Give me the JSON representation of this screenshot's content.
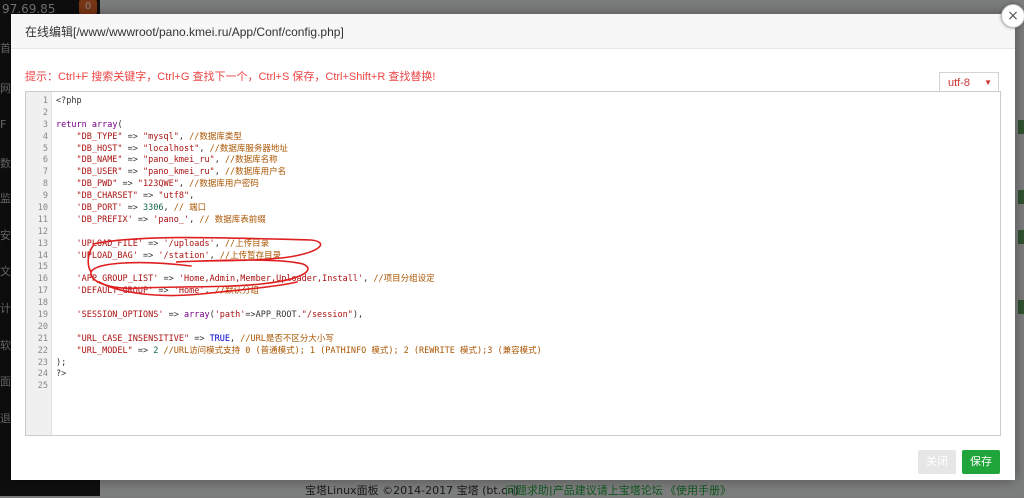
{
  "background": {
    "server_ip": "97.69.85",
    "badge": "0",
    "sidebar_glyphs": [
      "首",
      "网",
      "F",
      "数",
      "监",
      "安",
      "文",
      "计",
      "软",
      "面",
      "退"
    ],
    "footer": {
      "copyright": "宝塔Linux面板 ©2014-2017 宝塔 (bt.cn)",
      "forum_link": "问题求助|产品建议请上宝塔论坛",
      "manual_link": "《使用手册》"
    }
  },
  "modal": {
    "title": "在线编辑[/www/wwwroot/pano.kmei.ru/App/Conf/config.php]",
    "close_icon": "×",
    "hint": "提示：Ctrl+F 搜索关键字，Ctrl+G 查找下一个，Ctrl+S 保存，Ctrl+Shift+R 查找替换!",
    "encoding": {
      "selected": "utf-8",
      "caret": "▼"
    },
    "buttons": {
      "cancel": "关闭",
      "save": "保存"
    },
    "annotation_color": "#e02020",
    "accent_color": "#20a53a"
  },
  "editor": {
    "lines": [
      {
        "n": "1",
        "t": [
          [
            "p",
            "<?php"
          ]
        ]
      },
      {
        "n": "2",
        "t": []
      },
      {
        "n": "3",
        "t": [
          [
            "k",
            "return"
          ],
          [
            "p",
            " "
          ],
          [
            "k",
            "array"
          ],
          [
            "p",
            "("
          ]
        ]
      },
      {
        "n": "4",
        "t": [
          [
            "p",
            "    "
          ],
          [
            "s",
            "\"DB_TYPE\""
          ],
          [
            "p",
            " => "
          ],
          [
            "s",
            "\"mysql\""
          ],
          [
            "p",
            ", "
          ],
          [
            "c",
            "//数据库类型"
          ]
        ]
      },
      {
        "n": "5",
        "t": [
          [
            "p",
            "    "
          ],
          [
            "s",
            "\"DB_HOST\""
          ],
          [
            "p",
            " => "
          ],
          [
            "s",
            "\"localhost\""
          ],
          [
            "p",
            ", "
          ],
          [
            "c",
            "//数据库服务器地址"
          ]
        ]
      },
      {
        "n": "6",
        "t": [
          [
            "p",
            "    "
          ],
          [
            "s",
            "\"DB_NAME\""
          ],
          [
            "p",
            " => "
          ],
          [
            "s",
            "\"pano_kmei_ru\""
          ],
          [
            "p",
            ", "
          ],
          [
            "c",
            "//数据库名称"
          ]
        ]
      },
      {
        "n": "7",
        "t": [
          [
            "p",
            "    "
          ],
          [
            "s",
            "\"DB_USER\""
          ],
          [
            "p",
            " => "
          ],
          [
            "s",
            "\"pano_kmei_ru\""
          ],
          [
            "p",
            ", "
          ],
          [
            "c",
            "//数据库用户名"
          ]
        ]
      },
      {
        "n": "8",
        "t": [
          [
            "p",
            "    "
          ],
          [
            "s",
            "\"DB_PWD\""
          ],
          [
            "p",
            " => "
          ],
          [
            "s",
            "\"123QWE\""
          ],
          [
            "p",
            ", "
          ],
          [
            "c",
            "//数据库用户密码"
          ]
        ]
      },
      {
        "n": "9",
        "t": [
          [
            "p",
            "    "
          ],
          [
            "s",
            "\"DB_CHARSET\""
          ],
          [
            "p",
            " => "
          ],
          [
            "s",
            "\"utf8\""
          ],
          [
            "p",
            ","
          ]
        ]
      },
      {
        "n": "10",
        "t": [
          [
            "p",
            "    "
          ],
          [
            "s",
            "'DB_PORT'"
          ],
          [
            "p",
            " => "
          ],
          [
            "n",
            "3306"
          ],
          [
            "p",
            ", "
          ],
          [
            "c",
            "// 端口"
          ]
        ]
      },
      {
        "n": "11",
        "t": [
          [
            "p",
            "    "
          ],
          [
            "s",
            "'DB_PREFIX'"
          ],
          [
            "p",
            " => "
          ],
          [
            "s",
            "'pano_'"
          ],
          [
            "p",
            ", "
          ],
          [
            "c",
            "// 数据库表前缀"
          ]
        ]
      },
      {
        "n": "12",
        "t": []
      },
      {
        "n": "13",
        "t": [
          [
            "p",
            "    "
          ],
          [
            "s",
            "'UPLOAD_FILE'"
          ],
          [
            "p",
            " => "
          ],
          [
            "s",
            "'/uploads'"
          ],
          [
            "p",
            ", "
          ],
          [
            "c",
            "//上传目录"
          ]
        ]
      },
      {
        "n": "14",
        "t": [
          [
            "p",
            "    "
          ],
          [
            "s",
            "'UPLOAD_BAG'"
          ],
          [
            "p",
            " => "
          ],
          [
            "s",
            "'/station'"
          ],
          [
            "p",
            ", "
          ],
          [
            "c",
            "//上传暂存目录"
          ]
        ]
      },
      {
        "n": "15",
        "t": []
      },
      {
        "n": "16",
        "t": [
          [
            "p",
            "    "
          ],
          [
            "s",
            "'APP_GROUP_LIST'"
          ],
          [
            "p",
            " => "
          ],
          [
            "s",
            "'Home,Admin,Member,Uploader,Install'"
          ],
          [
            "p",
            ", "
          ],
          [
            "c",
            "//项目分组设定"
          ]
        ]
      },
      {
        "n": "17",
        "t": [
          [
            "p",
            "    "
          ],
          [
            "s",
            "'DEFAULT_GROUP'"
          ],
          [
            "p",
            " => "
          ],
          [
            "s",
            "'Home'"
          ],
          [
            "p",
            ", "
          ],
          [
            "c",
            "//默认分组"
          ]
        ]
      },
      {
        "n": "18",
        "t": []
      },
      {
        "n": "19",
        "t": [
          [
            "p",
            "    "
          ],
          [
            "s",
            "'SESSION_OPTIONS'"
          ],
          [
            "p",
            " => "
          ],
          [
            "k",
            "array"
          ],
          [
            "p",
            "("
          ],
          [
            "s",
            "'path'"
          ],
          [
            "p",
            "=>APP_ROOT."
          ],
          [
            "s",
            "\"/session\""
          ],
          [
            "p",
            "),"
          ]
        ]
      },
      {
        "n": "20",
        "t": []
      },
      {
        "n": "21",
        "t": [
          [
            "p",
            "    "
          ],
          [
            "s",
            "\"URL_CASE_INSENSITIVE\""
          ],
          [
            "p",
            " => "
          ],
          [
            "a",
            "TRUE"
          ],
          [
            "p",
            ", "
          ],
          [
            "c",
            "//URL是否不区分大小写"
          ]
        ]
      },
      {
        "n": "22",
        "t": [
          [
            "p",
            "    "
          ],
          [
            "s",
            "\"URL_MODEL\""
          ],
          [
            "p",
            " => "
          ],
          [
            "n",
            "2"
          ],
          [
            "p",
            " "
          ],
          [
            "c",
            "//URL访问模式支持 0 (普通模式); 1 (PATHINFO 模式); 2 (REWRITE 模式);3 (兼容模式)"
          ]
        ]
      },
      {
        "n": "23",
        "t": [
          [
            "p",
            ");"
          ]
        ]
      },
      {
        "n": "24",
        "t": [
          [
            "p",
            "?>"
          ]
        ]
      },
      {
        "n": "25",
        "t": []
      }
    ]
  }
}
